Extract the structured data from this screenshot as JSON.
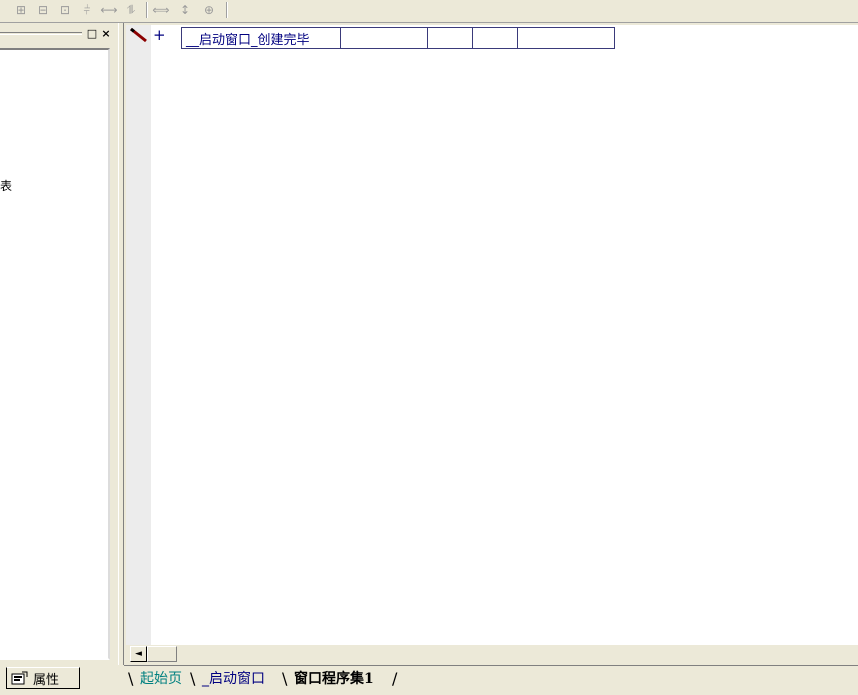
{
  "toolbar": {
    "buttons": [
      {
        "icon": "align-left-icon",
        "glyph": "⊞"
      },
      {
        "icon": "align-center-icon",
        "glyph": "⊟"
      },
      {
        "icon": "align-top-icon",
        "glyph": "⊡"
      },
      {
        "icon": "align-middle-icon",
        "glyph": "⫩"
      },
      {
        "icon": "space-horizontal-icon",
        "glyph": "⟷"
      },
      {
        "icon": "space-vertical-icon",
        "glyph": "⥮"
      },
      {
        "icon": "same-width-icon",
        "glyph": "⟺"
      },
      {
        "icon": "same-height-icon",
        "glyph": "↕"
      },
      {
        "icon": "same-size-icon",
        "glyph": "⊕"
      }
    ]
  },
  "left_panel": {
    "close_glyph": "×",
    "restore_glyph": "□",
    "partial_text": "表",
    "properties_tab_label": "属性"
  },
  "editor": {
    "plus": "+",
    "subroutine_row": [
      "__启动窗口_创建完毕",
      "",
      "",
      "",
      ""
    ]
  },
  "bottom_tabs": [
    {
      "label": "起始页",
      "active": false,
      "color": "#008080"
    },
    {
      "label": "_启动窗口",
      "active": false,
      "color": "#000080"
    },
    {
      "label": "窗口程序集1",
      "active": true,
      "color": "#000000"
    }
  ],
  "scrollbar": {
    "left_arrow": "◄"
  }
}
